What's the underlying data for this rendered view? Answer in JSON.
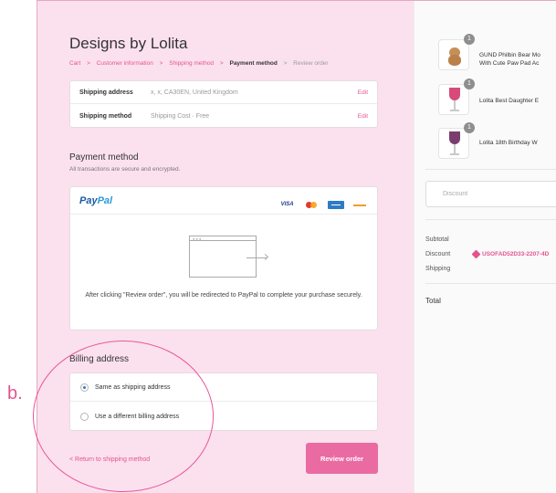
{
  "header": {
    "brand": "Designs by Lolita"
  },
  "breadcrumb": {
    "cart": "Cart",
    "customer_information": "Customer information",
    "shipping_method": "Shipping method",
    "payment_method": "Payment method",
    "review_order": "Review order",
    "separator": ">"
  },
  "review": {
    "shipping_address_label": "Shipping address",
    "shipping_address_value": "x, x, CA30EN, United Kingdom",
    "shipping_method_label": "Shipping method",
    "shipping_method_value": "Shipping Cost · Free",
    "edit_label": "Edit"
  },
  "payment": {
    "title": "Payment method",
    "subtitle": "All transactions are secure and encrypted.",
    "provider_logo_part1": "Pay",
    "provider_logo_part2": "Pal",
    "card_visa": "VISA",
    "redirect_message": "After clicking \"Review order\", you will be redirected to PayPal to complete your purchase securely."
  },
  "billing": {
    "title": "Billing address",
    "option_same": "Same as shipping address",
    "option_different": "Use a different billing address",
    "selected": "same"
  },
  "footer": {
    "back_link": "< Return to shipping method",
    "review_button": "Review order"
  },
  "annotation": {
    "letter": "b."
  },
  "order_summary": {
    "products": [
      {
        "qty": "1",
        "name_line1": "GUND Philbin Bear Mo",
        "name_line2": "With Cute Paw Pad Ac",
        "icon": "teddy-bear"
      },
      {
        "qty": "1",
        "name_line1": "Lolita Best Daughter E",
        "name_line2": "",
        "icon": "wine-glass"
      },
      {
        "qty": "1",
        "name_line1": "Lolita 18th Birthday W",
        "name_line2": "",
        "icon": "wine-glass"
      }
    ],
    "discount_placeholder": "Discount",
    "subtotal_label": "Subtotal",
    "discount_label": "Discount",
    "discount_code": "USOFAD52D33-2207-4D",
    "shipping_label": "Shipping",
    "total_label": "Total"
  },
  "colors": {
    "accent": "#e3548f",
    "button": "#ea6ba2",
    "panel_bg": "#fbe1ee",
    "annotation": "#e8579a"
  }
}
